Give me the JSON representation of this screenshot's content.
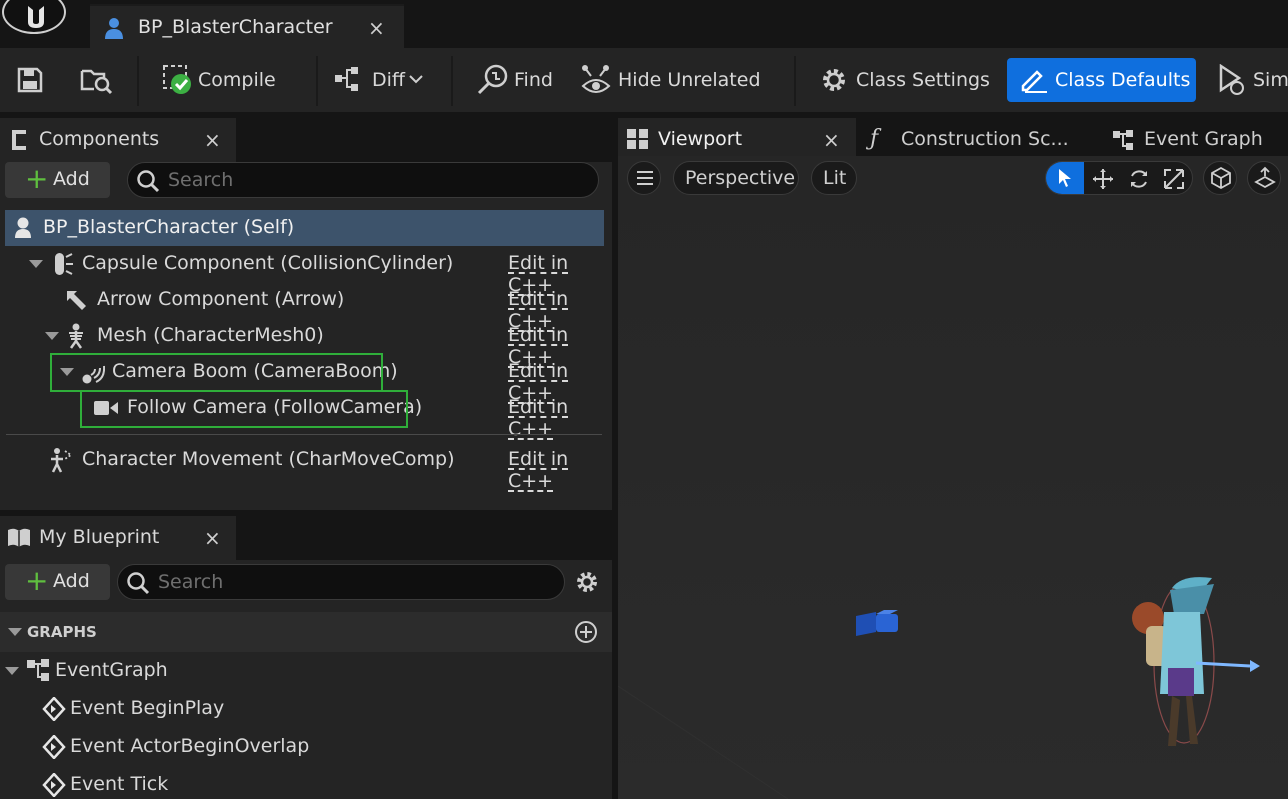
{
  "window": {
    "doc_tab_title": "BP_BlasterCharacter",
    "doc_tab_close": "×"
  },
  "toolbar": {
    "compile_label": "Compile",
    "diff_label": "Diff",
    "find_label": "Find",
    "hide_unrelated_label": "Hide Unrelated",
    "class_settings_label": "Class Settings",
    "class_defaults_label": "Class Defaults",
    "simulate_label": "Sim"
  },
  "components": {
    "tab_title": "Components",
    "tab_close": "×",
    "add_label": "Add",
    "search_placeholder": "Search",
    "rows": [
      {
        "name": "BP_BlasterCharacter (Self)",
        "edit": ""
      },
      {
        "name": "Capsule Component (CollisionCylinder)",
        "edit": "Edit in C++"
      },
      {
        "name": "Arrow Component (Arrow)",
        "edit": "Edit in C++"
      },
      {
        "name": "Mesh (CharacterMesh0)",
        "edit": "Edit in C++"
      },
      {
        "name": "Camera Boom (CameraBoom)",
        "edit": "Edit in C++"
      },
      {
        "name": "Follow Camera (FollowCamera)",
        "edit": "Edit in C++"
      },
      {
        "name": "Character Movement (CharMoveComp)",
        "edit": "Edit in C++"
      }
    ]
  },
  "my_blueprint": {
    "tab_title": "My Blueprint",
    "tab_close": "×",
    "add_label": "Add",
    "search_placeholder": "Search",
    "graphs_header": "GRAPHS",
    "event_graph": "EventGraph",
    "events": [
      "Event BeginPlay",
      "Event ActorBeginOverlap",
      "Event Tick"
    ]
  },
  "viewport": {
    "tabs": [
      {
        "label": "Viewport",
        "close": "×"
      },
      {
        "label": "Construction Sc..."
      },
      {
        "label": "Event Graph"
      }
    ],
    "perspective_label": "Perspective",
    "lit_label": "Lit"
  },
  "colors": {
    "accent_blue": "#0f6fde",
    "highlight_green": "#2fae3a",
    "selected_row": "#3d536b",
    "add_plus": "#5fbf3f"
  }
}
